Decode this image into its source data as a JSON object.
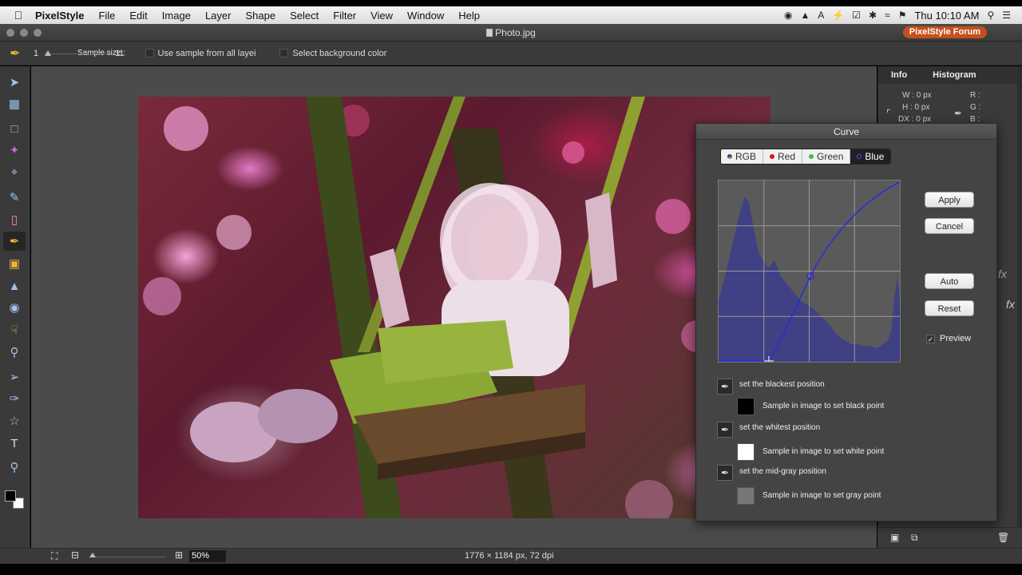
{
  "menubar": {
    "app_name": "PixelStyle",
    "items": [
      "File",
      "Edit",
      "Image",
      "Layer",
      "Shape",
      "Select",
      "Filter",
      "View",
      "Window",
      "Help"
    ],
    "clock": "Thu 10:10 AM"
  },
  "window": {
    "doc_title": "Photo.jpg",
    "forum_button": "PixelStyle Forum"
  },
  "options": {
    "sample_size_label": "Sample size :",
    "sample_min": "1",
    "sample_max": "11",
    "use_all_layers": "Use sample from all layei",
    "select_bg_color": "Select background color"
  },
  "panels": {
    "tab_info": "Info",
    "tab_histogram": "Histogram",
    "w": "W :  0 px",
    "h": "H :  0 px",
    "dx": "DX :  0 px",
    "r": "R :",
    "g": "G :",
    "b": "B :"
  },
  "status": {
    "zoom": "50%",
    "dimensions": "1776 × 1184 px, 72 dpi"
  },
  "curve": {
    "title": "Curve",
    "channels": [
      "RGB",
      "Red",
      "Green",
      "Blue"
    ],
    "active_channel": "Blue",
    "apply": "Apply",
    "cancel": "Cancel",
    "auto": "Auto",
    "reset": "Reset",
    "preview": "Preview",
    "preview_checked": true,
    "blackest_label": "set the blackest position",
    "black_sample_label": "Sample in image to set black point",
    "whitest_label": "set the whitest position",
    "white_sample_label": "Sample in image to set white point",
    "midgray_label": "set the mid-gray position",
    "gray_sample_label": "Sample in image to set gray point",
    "channel_colors": {
      "RGB": "#888888",
      "Red": "#e0102a",
      "Green": "#38c238",
      "Blue": "#2a2ae0"
    }
  }
}
